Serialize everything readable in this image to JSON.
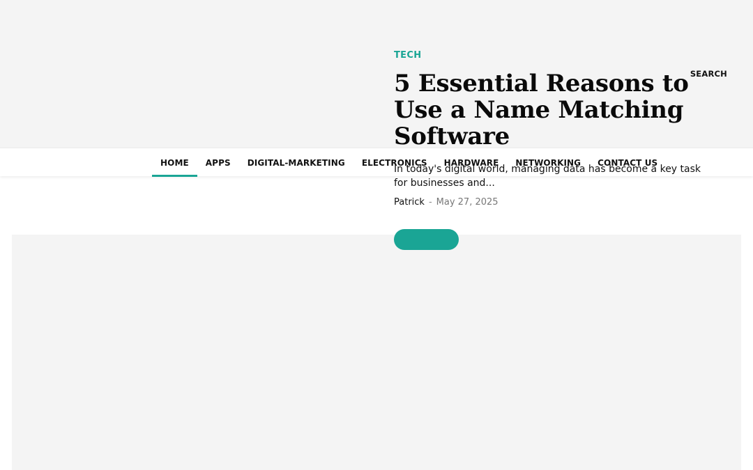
{
  "header": {
    "search_label": "SEARCH"
  },
  "nav": {
    "items": [
      {
        "label": "HOME",
        "active": true
      },
      {
        "label": "APPS"
      },
      {
        "label": "DIGITAL-MARKETING"
      },
      {
        "label": "ELECTRONICS"
      },
      {
        "label": "HARDWARE"
      },
      {
        "label": "NETWORKING"
      },
      {
        "label": "CONTACT US"
      }
    ]
  },
  "featured": {
    "category": "TECH",
    "title": "5 Essential Reasons to Use a Name Matching Software",
    "excerpt": "In today's digital world, managing data has become a key task for businesses and...",
    "author": "Patrick",
    "separator": "-",
    "date": "May 27, 2025"
  },
  "colors": {
    "accent": "#1aa595",
    "header_bg": "#f4f4f4",
    "text": "#111111"
  }
}
